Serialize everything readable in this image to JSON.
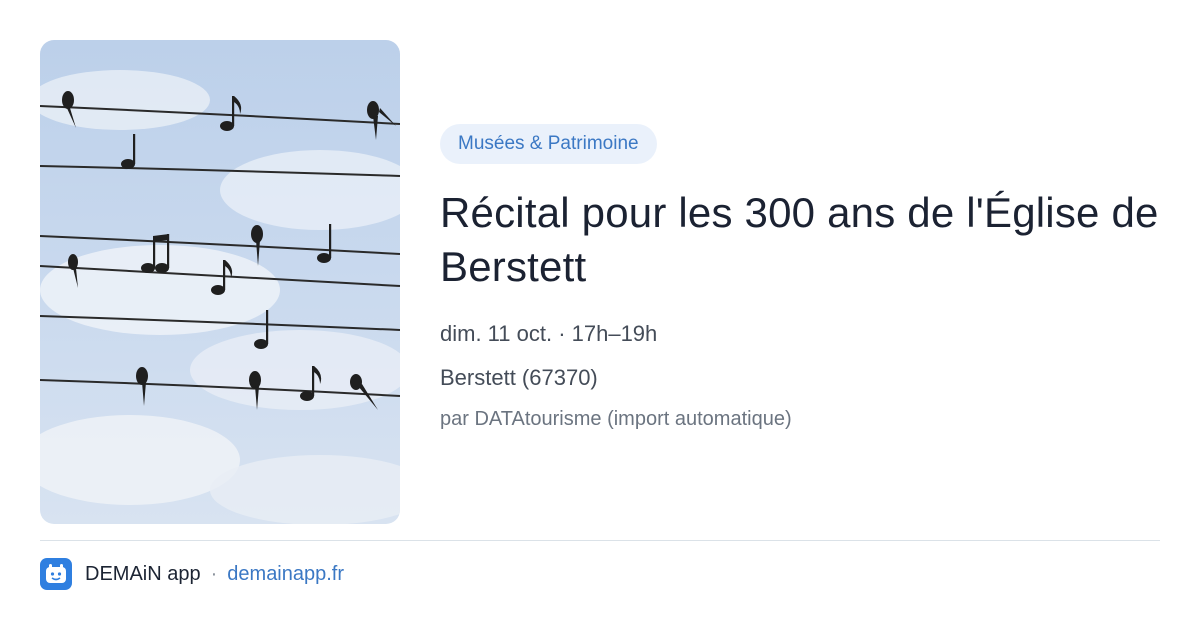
{
  "event": {
    "category": "Musées & Patrimoine",
    "title": "Récital pour les 300 ans de l'Église de Berstett",
    "date": "dim. 11 oct. · 17h–19h",
    "location": "Berstett (67370)",
    "source": "par DATAtourisme (import automatique)"
  },
  "footer": {
    "app_name": "DEMAiN app",
    "separator": "·",
    "site": "demainapp.fr"
  },
  "colors": {
    "accent": "#3b78c4",
    "badge_bg": "#eaf1fb",
    "app_icon": "#2f7fe0"
  },
  "icons": {
    "app_logo": "demain-app-icon"
  }
}
